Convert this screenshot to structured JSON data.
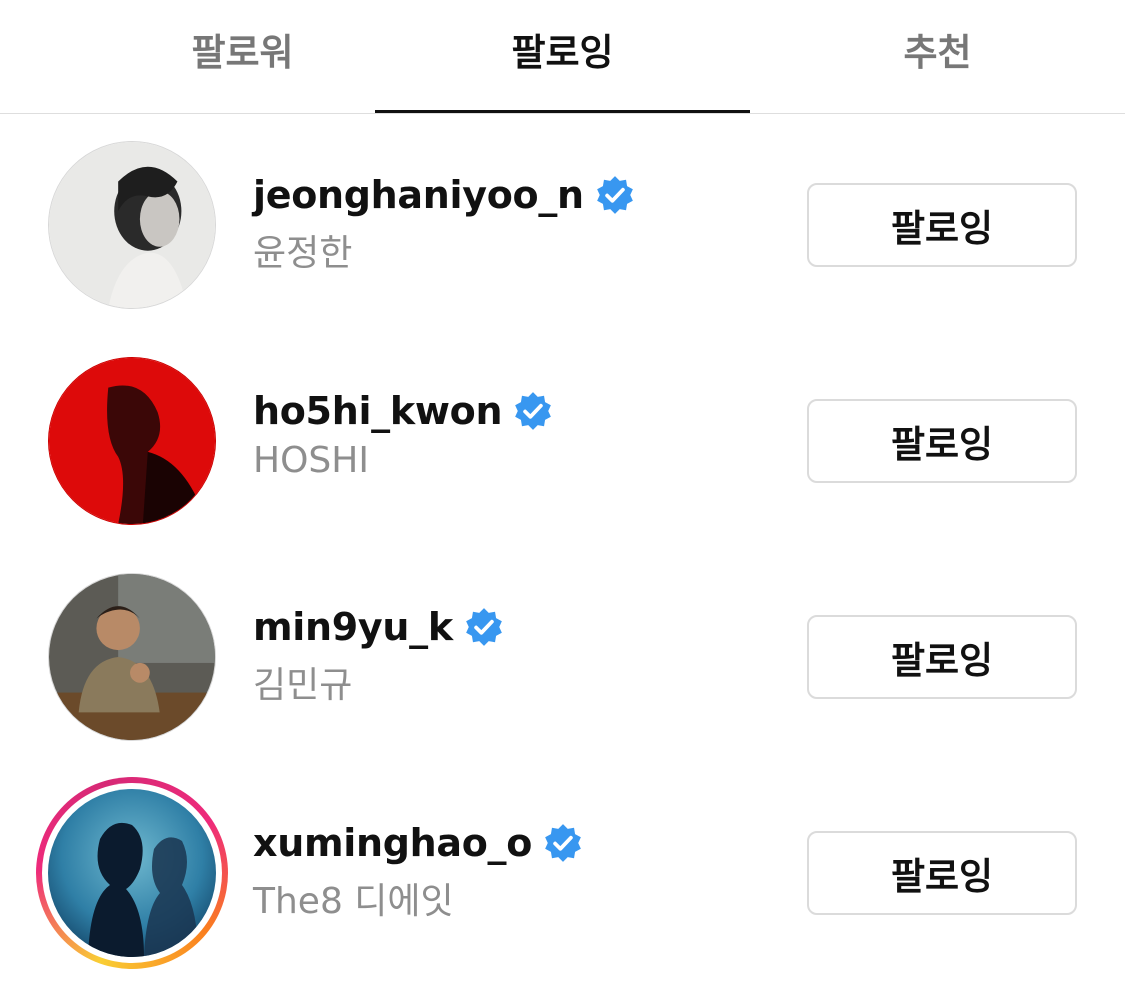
{
  "tabs": [
    {
      "label": "팔로워",
      "active": false
    },
    {
      "label": "팔로잉",
      "active": true
    },
    {
      "label": "추천",
      "active": false
    }
  ],
  "accounts": [
    {
      "username": "jeonghaniyoo_n",
      "full_name": "윤정한",
      "verified": true,
      "button_label": "팔로잉",
      "has_story": false
    },
    {
      "username": "ho5hi_kwon",
      "full_name": "HOSHI",
      "verified": true,
      "button_label": "팔로잉",
      "has_story": false
    },
    {
      "username": "min9yu_k",
      "full_name": "김민규",
      "verified": true,
      "button_label": "팔로잉",
      "has_story": false
    },
    {
      "username": "xuminghao_o",
      "full_name": "The8 디에잇",
      "verified": true,
      "button_label": "팔로잉",
      "has_story": true
    }
  ],
  "icons": {
    "verified": "verified-badge-icon"
  },
  "colors": {
    "verified_blue": "#3897f0",
    "text_secondary": "#8e8e8e",
    "border": "#dbdbdb"
  }
}
